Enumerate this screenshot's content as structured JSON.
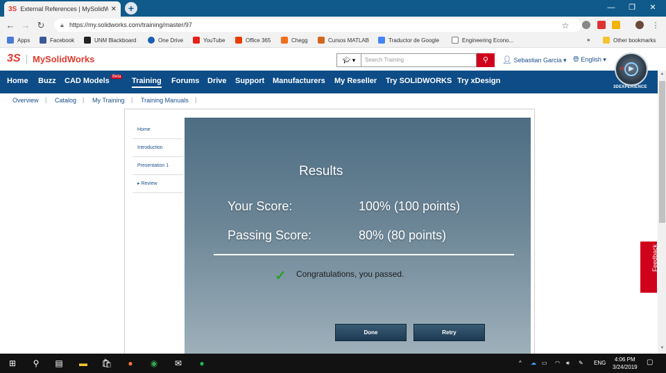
{
  "browser": {
    "tab_title": "External References | MySolidWo",
    "tab_close": "✕",
    "new_tab": "+",
    "url": "https://my.solidworks.com/training/master/97",
    "window_controls": [
      "—",
      "❐",
      "✕"
    ]
  },
  "bookmarks": {
    "items": [
      "Apps",
      "Facebook",
      "UNM Blackboard",
      "One Drive",
      "YouTube",
      "Office 365",
      "Chegg",
      "Cursos MATLAB",
      "Traductor de Google",
      "Engineering Econo..."
    ],
    "overflow": "»",
    "other": "Other bookmarks"
  },
  "header": {
    "brand": "MySolidWorks",
    "search_placeholder": "Search Training",
    "user_name": "Sebastian Garcia ▾",
    "language": "English ▾",
    "experience_label": "3DEXPERIENCE"
  },
  "nav": {
    "items": [
      "Home",
      "Buzz",
      "CAD Models",
      "Training",
      "Forums",
      "Drive",
      "Support",
      "Manufacturers",
      "My Reseller",
      "Try SOLIDWORKS",
      "Try xDesign"
    ],
    "beta_badge": "Beta"
  },
  "subnav": {
    "items": [
      "Overview",
      "Catalog",
      "My Training",
      "Training Manuals"
    ]
  },
  "course_menu": {
    "items": [
      "Home",
      "Introduction",
      "Presentation 1",
      "▸ Review"
    ]
  },
  "results": {
    "title": "Results",
    "your_score_label": "Your Score:",
    "your_score_value": "100% (100 points)",
    "passing_score_label": "Passing Score:",
    "passing_score_value": "80% (80 points)",
    "message": "Congratulations, you passed.",
    "done_label": "Done",
    "retry_label": "Retry"
  },
  "feedback": {
    "label": "Feedback"
  },
  "taskbar": {
    "language": "ENG",
    "time": "4:06 PM",
    "date": "3/24/2019"
  },
  "colors": {
    "brand_red": "#e03a2e",
    "nav_blue": "#0d4c86",
    "link_blue": "#1a4f8b",
    "check_green": "#2aa02a"
  }
}
